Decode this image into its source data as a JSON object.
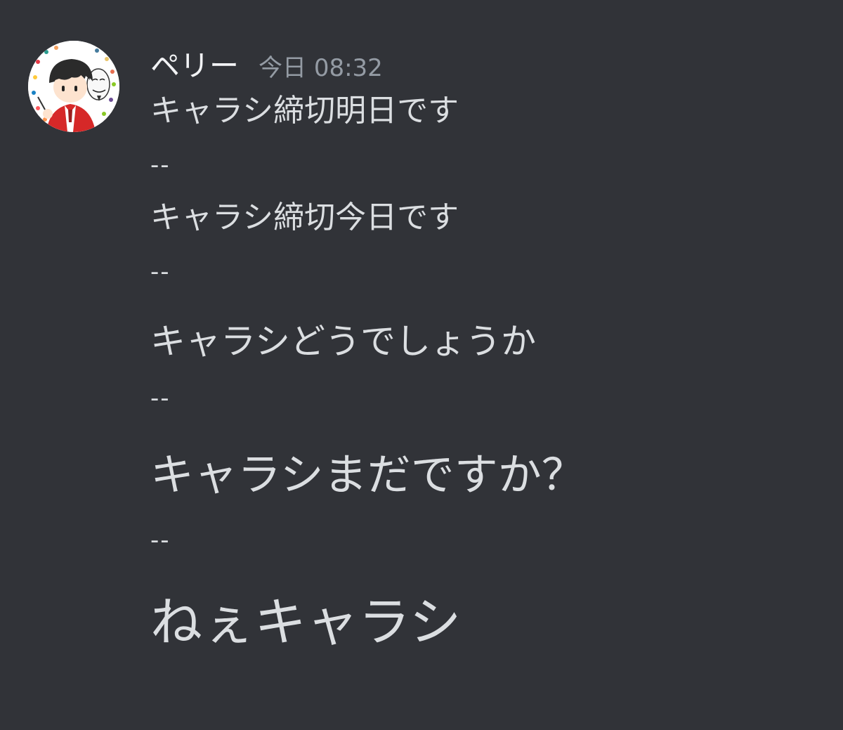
{
  "message": {
    "username": "ペリー",
    "timestamp": "今日 08:32",
    "lines": [
      "キャラシ締切明日です",
      "--",
      "キャラシ締切今日です",
      "--",
      "キャラシどうでしょうか",
      "--",
      "キャラシまだですか？",
      "--",
      "ねぇキャラシ"
    ]
  },
  "colors": {
    "background": "#313338",
    "username": "#f2f3f5",
    "timestamp": "#949ba4",
    "text": "#dbdee1"
  }
}
